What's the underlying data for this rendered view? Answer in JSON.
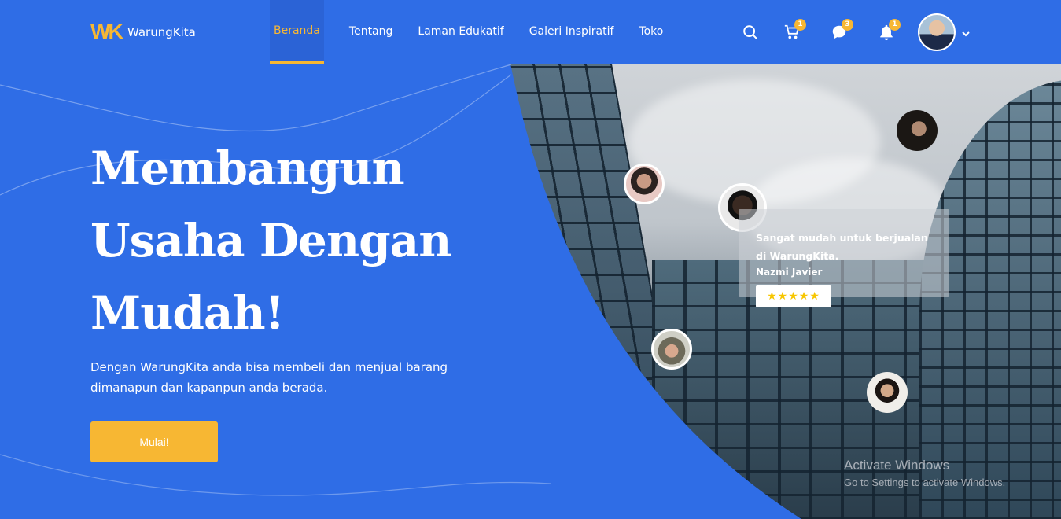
{
  "brand": {
    "mark": "WK",
    "name": "WarungKita"
  },
  "nav": {
    "links": [
      "Beranda",
      "Tentang",
      "Laman Edukatif",
      "Galeri Inspiratif",
      "Toko"
    ],
    "active": "Beranda"
  },
  "icons": {
    "search": "search-icon",
    "cart": {
      "icon": "cart-icon",
      "badge": "1"
    },
    "chat": {
      "icon": "chat-icon",
      "badge": "3"
    },
    "bell": {
      "icon": "bell-icon",
      "badge": "1"
    },
    "profile_menu": "chevron-down-icon"
  },
  "hero": {
    "title_lines": [
      "Membangun",
      "Usaha Dengan",
      "Mudah!"
    ],
    "subtitle": "Dengan WarungKita anda bisa membeli dan menjual barang dimanapun dan kapanpun anda berada.",
    "cta_label": "Mulai!"
  },
  "testimonial": {
    "quote": "Sangat mudah untuk berjualan di WarungKita.",
    "author": "Nazmi Javier",
    "rating": 5,
    "stars": "★★★★★"
  },
  "watermark": {
    "title": "Activate Windows",
    "subtitle": "Go to Settings to activate Windows."
  },
  "colors": {
    "primary": "#2f6de6",
    "accent": "#f7b733",
    "text": "#ffffff"
  }
}
